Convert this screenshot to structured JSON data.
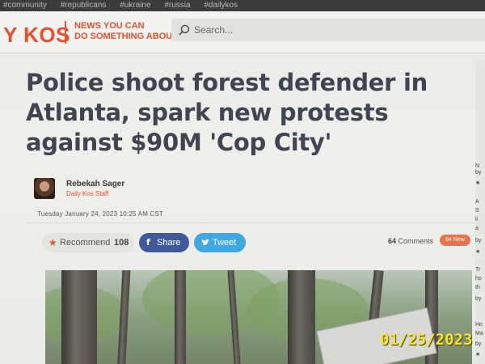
{
  "tag_bar": {
    "tags": [
      "#community",
      "#republicans",
      "#ukraine",
      "#russia",
      "#dailykos"
    ]
  },
  "header": {
    "logo": "Y KOS",
    "tagline_line1": "NEWS YOU CAN",
    "tagline_line2": "DO SOMETHING ABOUT",
    "search": {
      "placeholder": "Search..."
    }
  },
  "article": {
    "headline": "Police shoot forest defender in Atlanta, spark new protests against $90M 'Cop City'",
    "author": {
      "name": "Rebekah Sager",
      "role": "Daily Kos Staff"
    },
    "dateline": "Tuesday January 24, 2023   10:25 AM CST",
    "actions": {
      "recommend_label": "Recommend",
      "recommend_count": "108",
      "share_label": "Share",
      "tweet_label": "Tweet",
      "comments_count": "64",
      "comments_label": "Comments",
      "new_badge": "64 New"
    }
  },
  "sidebar": {
    "snippets": [
      "N",
      "by",
      "★",
      "A",
      "S",
      "li",
      "a",
      "by",
      "★",
      "Tr",
      "ho",
      "th",
      "by",
      "Ho",
      "Ma",
      "by",
      "★"
    ]
  },
  "photo_stamp": "01/25/2023",
  "colors": {
    "brand": "#e8502d",
    "facebook": "#3e5a9a",
    "twitter": "#3fa7e2",
    "headline": "#404552"
  }
}
